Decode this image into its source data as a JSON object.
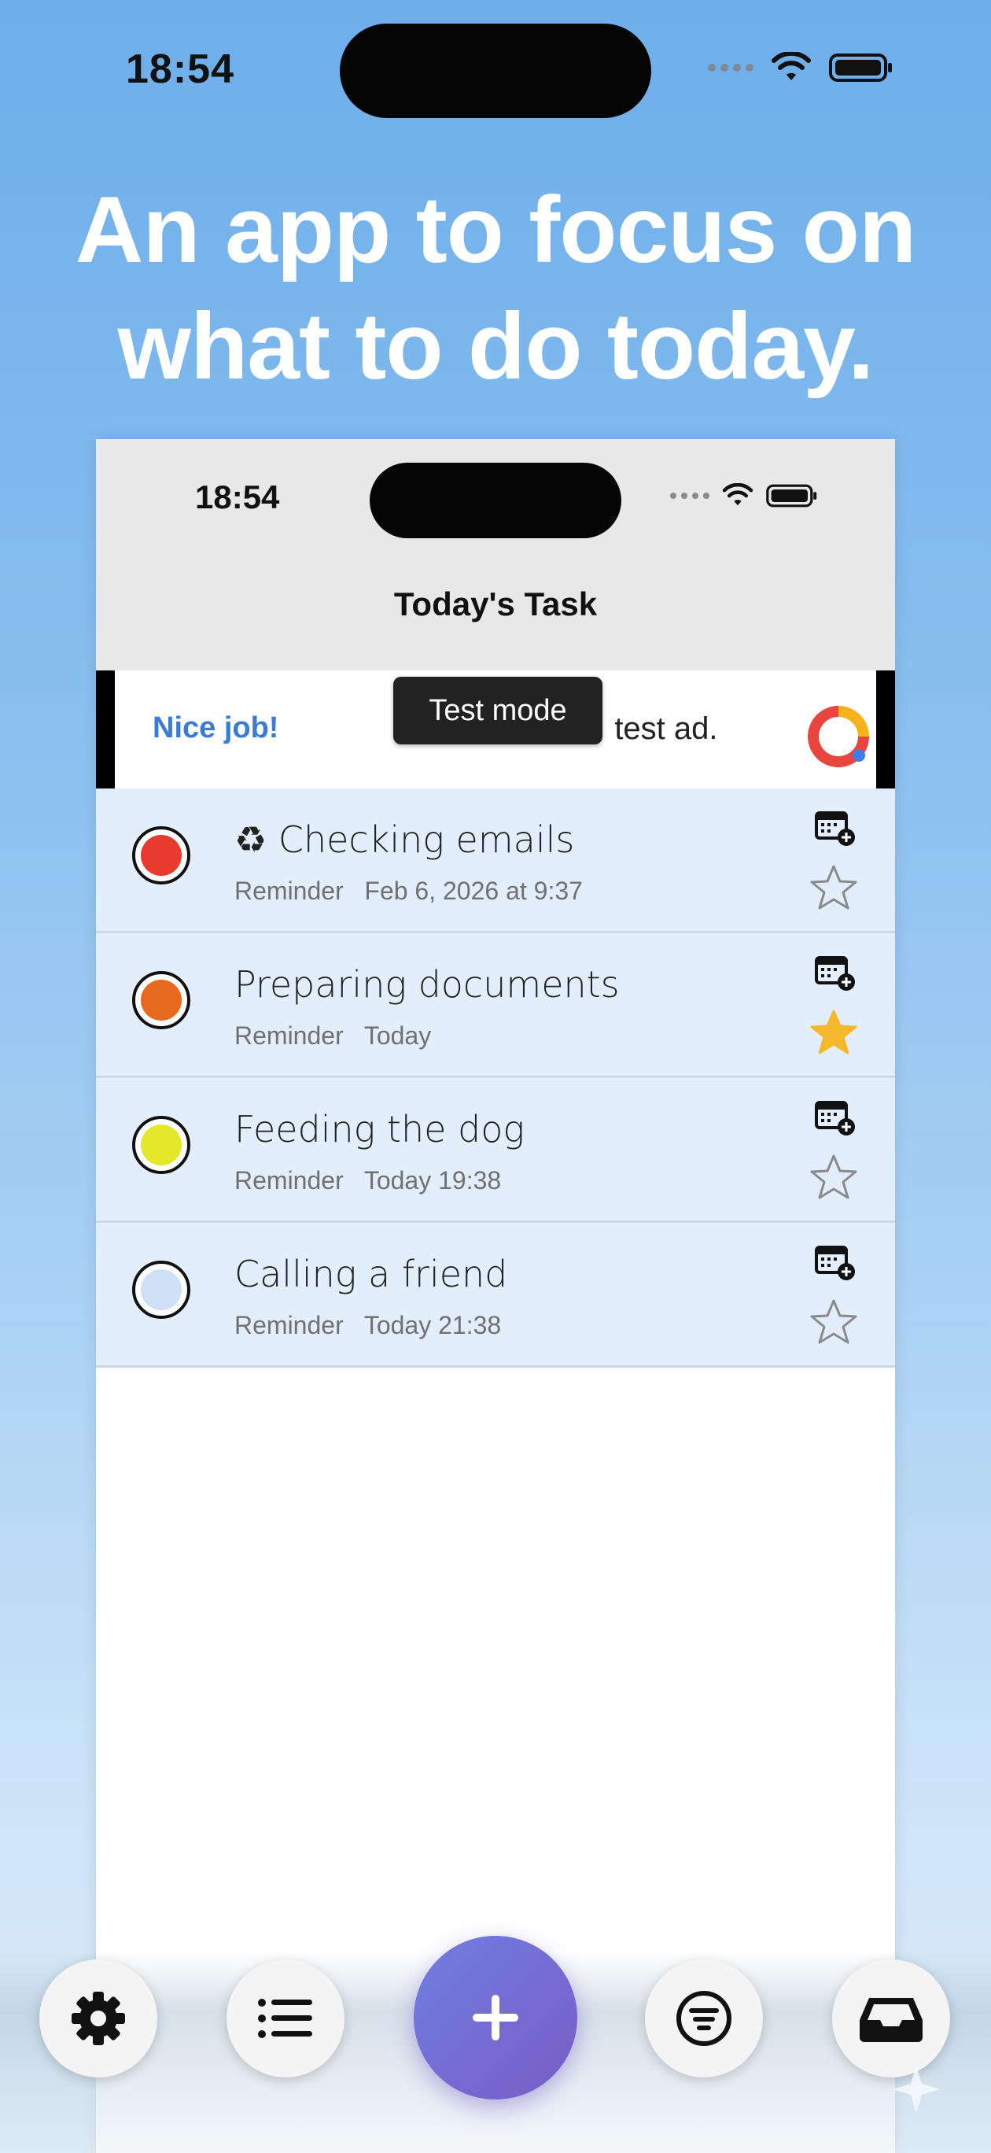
{
  "status_bar": {
    "time": "18:54"
  },
  "headline": {
    "line1": "An app to focus on",
    "line2": "what to do today."
  },
  "inner_status_bar": {
    "time": "18:54"
  },
  "nav": {
    "title": "Today's Task"
  },
  "ad": {
    "nice_job": "Nice job!",
    "text": "T                       test ad.",
    "tooltip": "Test mode"
  },
  "tasks": [
    {
      "title": "♻ Checking emails",
      "meta_label": "Reminder",
      "meta_time": "Feb 6, 2026 at 9:37",
      "priority_color": "#e83a2e",
      "starred": false
    },
    {
      "title": "Preparing documents",
      "meta_label": "Reminder",
      "meta_time": "Today",
      "priority_color": "#e86a1e",
      "starred": true
    },
    {
      "title": "Feeding the dog",
      "meta_label": "Reminder",
      "meta_time": "Today 19:38",
      "priority_color": "#e4ea2a",
      "starred": false
    },
    {
      "title": "Calling a friend",
      "meta_label": "Reminder",
      "meta_time": "Today 21:38",
      "priority_color": "#cfe0f7",
      "starred": false
    }
  ],
  "toolbar": {
    "items": [
      "gear-icon",
      "list-icon",
      "plus-icon",
      "filter-icon",
      "inbox-icon"
    ]
  },
  "colors": {
    "accent": "#1e7be0",
    "star_on": "#f5b82a",
    "add_button": "#7566d4",
    "nice_job": "#3a7bd5"
  }
}
